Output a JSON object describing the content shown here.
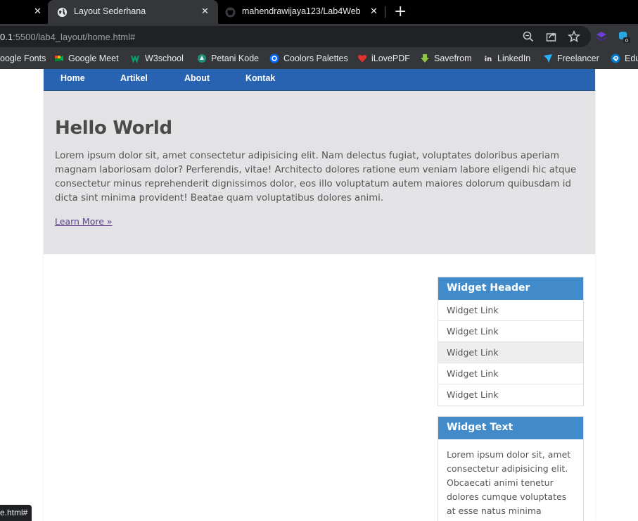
{
  "browser": {
    "tabs": [
      {
        "title": "",
        "icon": "close-icon",
        "active": false
      },
      {
        "title": "Layout Sederhana",
        "icon": "globe-icon",
        "active": true
      },
      {
        "title": "mahendrawijaya123/Lab4Web",
        "icon": "github-icon",
        "active": false
      }
    ],
    "url": {
      "host": "0.1",
      "path": ":5500/lab4_layout/home.html#"
    },
    "status_text": "e.html#",
    "colors": {
      "tabstrip": "#000000",
      "toolbar": "#35363a",
      "omnibox": "#202124"
    }
  },
  "bookmarks": [
    {
      "label": "oogle Fonts",
      "icon": "none"
    },
    {
      "label": "Google Meet",
      "icon": "google-meet-icon"
    },
    {
      "label": "W3school",
      "icon": "w3schools-icon"
    },
    {
      "label": "Petani Kode",
      "icon": "petani-kode-icon"
    },
    {
      "label": "Coolors Palettes",
      "icon": "coolors-icon"
    },
    {
      "label": "iLovePDF",
      "icon": "ilovepdf-icon"
    },
    {
      "label": "Savefrom",
      "icon": "savefrom-icon"
    },
    {
      "label": "LinkedIn",
      "icon": "linkedin-icon"
    },
    {
      "label": "Freelancer",
      "icon": "freelancer-icon"
    },
    {
      "label": "Edu",
      "icon": "edge-icon"
    }
  ],
  "page": {
    "nav": [
      "Home",
      "Artikel",
      "About",
      "Kontak"
    ],
    "hero": {
      "title": "Hello World",
      "body": "Lorem ipsum dolor sit, amet consectetur adipisicing elit. Nam delectus fugiat, voluptates doloribus aperiam magnam laboriosam dolor? Perferendis, vitae! Architecto dolores ratione eum veniam labore eligendi hic atque consectetur minus reprehenderit dignissimos dolor, eos illo voluptatum autem maiores dolorum quibusdam id dicta sint minima provident! Beatae quam voluptatibus dolores animi.",
      "link": "Learn More »"
    },
    "widgets": {
      "links_header": "Widget Header",
      "links": [
        "Widget Link",
        "Widget Link",
        "Widget Link",
        "Widget Link",
        "Widget Link"
      ],
      "text_header": "Widget Text",
      "text_body": "Lorem ipsum dolor sit, amet consectetur adipisicing elit. Obcaecati animi tenetur dolores cumque voluptates at esse natus minima cupiditate"
    },
    "colors": {
      "nav": "#2763b0",
      "hero": "#e3e3e6",
      "widget_header": "#428bca"
    }
  }
}
